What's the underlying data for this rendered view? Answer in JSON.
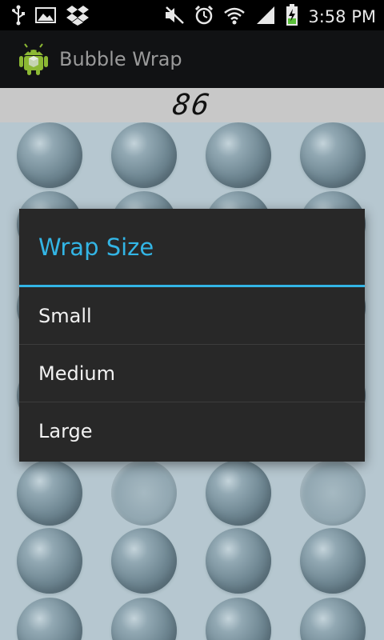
{
  "status_bar": {
    "time": "3:58 PM",
    "left_icons": [
      "usb-icon",
      "image-icon",
      "dropbox-icon"
    ],
    "right_icons": [
      "mute-icon",
      "alarm-icon",
      "wifi-icon",
      "signal-icon",
      "battery-charging-icon"
    ]
  },
  "app": {
    "title": "Bubble Wrap",
    "icon": "android-icon"
  },
  "counter": {
    "value": "86"
  },
  "dialog": {
    "title": "Wrap Size",
    "options": [
      {
        "label": "Small"
      },
      {
        "label": "Medium"
      },
      {
        "label": "Large"
      }
    ]
  },
  "colors": {
    "accent": "#33b5e5",
    "dialog_bg": "#282828",
    "bubble_bg": "#c2d2da"
  }
}
